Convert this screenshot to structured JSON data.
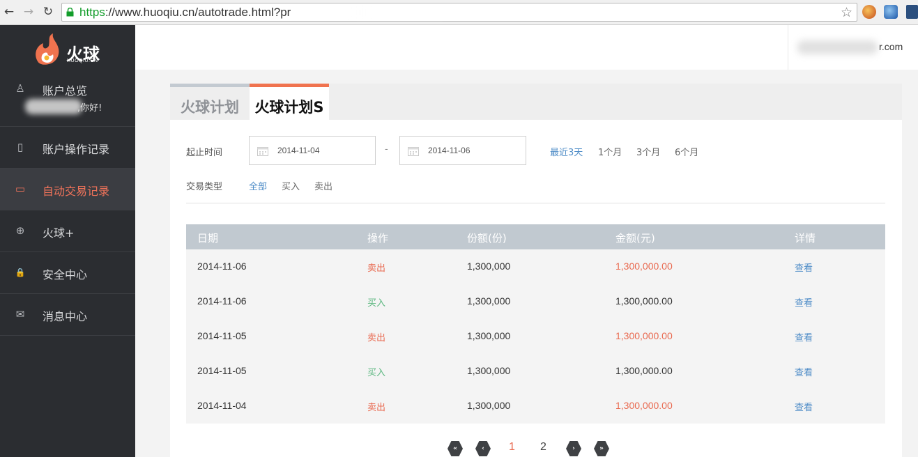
{
  "browser": {
    "url_scheme": "https",
    "url_rest": "://www.huoqiu.cn/autotrade.html?pr"
  },
  "logo": {
    "text": "火球",
    "sub": "HUOQIU.CN"
  },
  "sidebar": {
    "greeting": ",你好!",
    "items": [
      {
        "label": "账户总览",
        "icon": "user-icon",
        "glyph": "♙"
      },
      {
        "label": "账户操作记录",
        "icon": "notebook-icon",
        "glyph": "▯"
      },
      {
        "label": "自动交易记录",
        "icon": "laptop-icon",
        "glyph": "▭"
      },
      {
        "label": "火球+",
        "icon": "plus-circle-icon",
        "glyph": "⊕"
      },
      {
        "label": "安全中心",
        "icon": "lock-icon",
        "glyph": "🔒"
      },
      {
        "label": "消息中心",
        "icon": "mail-icon",
        "glyph": "✉"
      }
    ],
    "active_index": 2
  },
  "header": {
    "user_email_suffix": "r.com"
  },
  "tabs": [
    {
      "label": "火球计划"
    },
    {
      "label": "火球计划S"
    }
  ],
  "filters": {
    "date_label": "起止时间",
    "start_date": "2014-11-04",
    "end_date": "2014-11-06",
    "range_separator": "-",
    "quick_ranges": [
      "最近3天",
      "1个月",
      "3个月",
      "6个月"
    ],
    "type_label": "交易类型",
    "types": [
      "全部",
      "买入",
      "卖出"
    ]
  },
  "table": {
    "headers": [
      "日期",
      "操作",
      "份额(份)",
      "金额(元)",
      "详情"
    ],
    "rows": [
      {
        "date": "2014-11-06",
        "op": "卖出",
        "shares": "1,300,000",
        "amount": "1,300,000.00",
        "detail": "查看"
      },
      {
        "date": "2014-11-06",
        "op": "买入",
        "shares": "1,300,000",
        "amount": "1,300,000.00",
        "detail": "查看"
      },
      {
        "date": "2014-11-05",
        "op": "卖出",
        "shares": "1,300,000",
        "amount": "1,300,000.00",
        "detail": "查看"
      },
      {
        "date": "2014-11-05",
        "op": "买入",
        "shares": "1,300,000",
        "amount": "1,300,000.00",
        "detail": "查看"
      },
      {
        "date": "2014-11-04",
        "op": "卖出",
        "shares": "1,300,000",
        "amount": "1,300,000.00",
        "detail": "查看"
      }
    ]
  },
  "pager": {
    "first": "«",
    "prev": "‹",
    "pages": [
      "1",
      "2"
    ],
    "next": "›",
    "last": "»",
    "current": "1"
  },
  "colors": {
    "accent": "#f0734f",
    "link": "#4e8cc7",
    "sell": "#e9694f",
    "buy": "#5bb77f",
    "sidebar": "#2b2d31"
  }
}
